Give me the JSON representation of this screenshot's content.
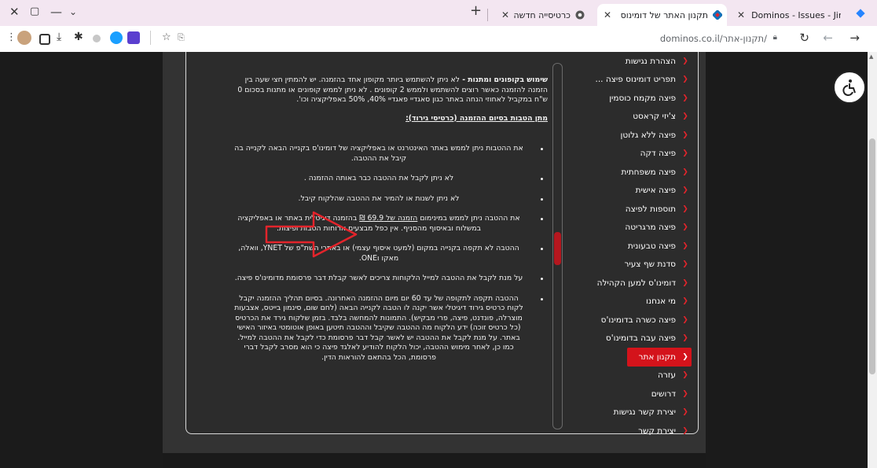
{
  "browser": {
    "tabs": [
      {
        "title": "Dominos - Issues - Jira",
        "active": false
      },
      {
        "title": "תקנון האתר של דומינוס פיצה | ...",
        "active": true
      },
      {
        "title": "כרטיסייה חדשה",
        "active": false
      }
    ],
    "url": "dominos.co.il/תקנון-אתר/"
  },
  "sidebar": {
    "items": [
      {
        "label": "הצהרת נגישות"
      },
      {
        "label": "תפריט דומינוס פיצה ..."
      },
      {
        "label": "פיצה מקמח כוסמין"
      },
      {
        "label": "צ'יזי קראסט"
      },
      {
        "label": "פיצה ללא גלוטן"
      },
      {
        "label": "פיצה דקה"
      },
      {
        "label": "פיצה משפחתית"
      },
      {
        "label": "פיצה אישית"
      },
      {
        "label": "תוספות לפיצה"
      },
      {
        "label": "פיצה מרגריטה"
      },
      {
        "label": "פיצה טבעונית"
      },
      {
        "label": "סדנת שף צעיר"
      },
      {
        "label": "דומינו'ס למען הקהילה"
      },
      {
        "label": "מי אנחנו"
      },
      {
        "label": "פיצה כשרה בדומינו'ס"
      },
      {
        "label": "פיצה עבה בדומינו'ס"
      },
      {
        "label": "תקנון אתר",
        "active": true
      },
      {
        "label": "עזרה"
      },
      {
        "label": "דרושים"
      },
      {
        "label": "יצירת קשר נגישות"
      },
      {
        "label": "יצירת קשר"
      }
    ]
  },
  "terms": {
    "coupon_title": "שימוש בקופונים ומתנות - ",
    "coupon_body": "לא ניתן להשתמש ביותר מקופון אחד בהזמנה. יש להמתין חצי שעה בין הזמנה להזמנה כאשר רוצים להשתמש ולממש 2 קופונים . לא ניתן לממש קופונים או מתנות בסכום 0 ש\"ח במקביל לאחוזי הנחה באתר כגון סאגדיי פאגדיי 40%, 50% באפליקציה וכו'.",
    "gift_title": "מתן הטבות בסיום ההזמנה (כרטיסי גירוד):",
    "bullets": [
      "את ההטבות ניתן לממש באתר האינטרנט או באפליקציה של דומינו'ס בקנייה הבאה לקנייה בה קיבל את ההטבה.",
      "לא ניתן לקבל את ההטבה כבר באותה ההזמנה .",
      "לא ניתן לשנות או להמיר את ההטבה שהלקוח קיבל."
    ],
    "min_order_pre": "את ההטבה ניתן לממש במינימום ",
    "min_order_link": "הזמנה של 69.9 ₪",
    "min_order_post": " בהזמנה דיגיטלית באתר או באפליקציה במשלוח ובאיסוף מהסניף. אין כפל מבצעים ארוחות הטבות ופיצות.",
    "bullets2": [
      "ההטבה לא תקפה בקנייה במקום (למעט איסוף עצמי) או באתרי השת\"פ של YNET, וואלה, מאקו וONE.",
      "על מנת לקבל את ההטבה למייל הלקוחות צריכים לאשר קבלת דבר פרסומת מדומינו'ס פיצה.",
      "ההטבה תקפה לתקופה של עד 60 יום מיום ההזמנה האחרונה. בסיום תהליך ההזמנה יקבל לקוח כרטיס גירוד דיגיטלי אשר יקנה לו הטבה לקנייה הבאה (לחם שום, סינמון בייטס, אצבעות מוצרלה, פונדנט, פיצה, פרי מבקיש). התמונות להמחשה בלבד. בזמן שלקוח גירד את הכרטיס (כל כרטיס זוכה) ידע הלקוח מה ההטבה שקיבל וההטבה תיטען באופן אוטומטי באיזור האישי באתר. על מנת לקבל את ההטבה יש לאשר קבל דבר פרסומת כדי לקבל את ההטבה למייל. כמו כן, לאחר מימוש ההטבה, יכול הלקוח להודיע לאלגד פיצה כי הוא מסרב לקבל דברי פרסומת, הכל בהתאם להוראות הדין."
    ]
  },
  "colors": {
    "accent": "#d4131b",
    "arrow": "#e3242b",
    "panel_bg": "#2c2c2c"
  }
}
